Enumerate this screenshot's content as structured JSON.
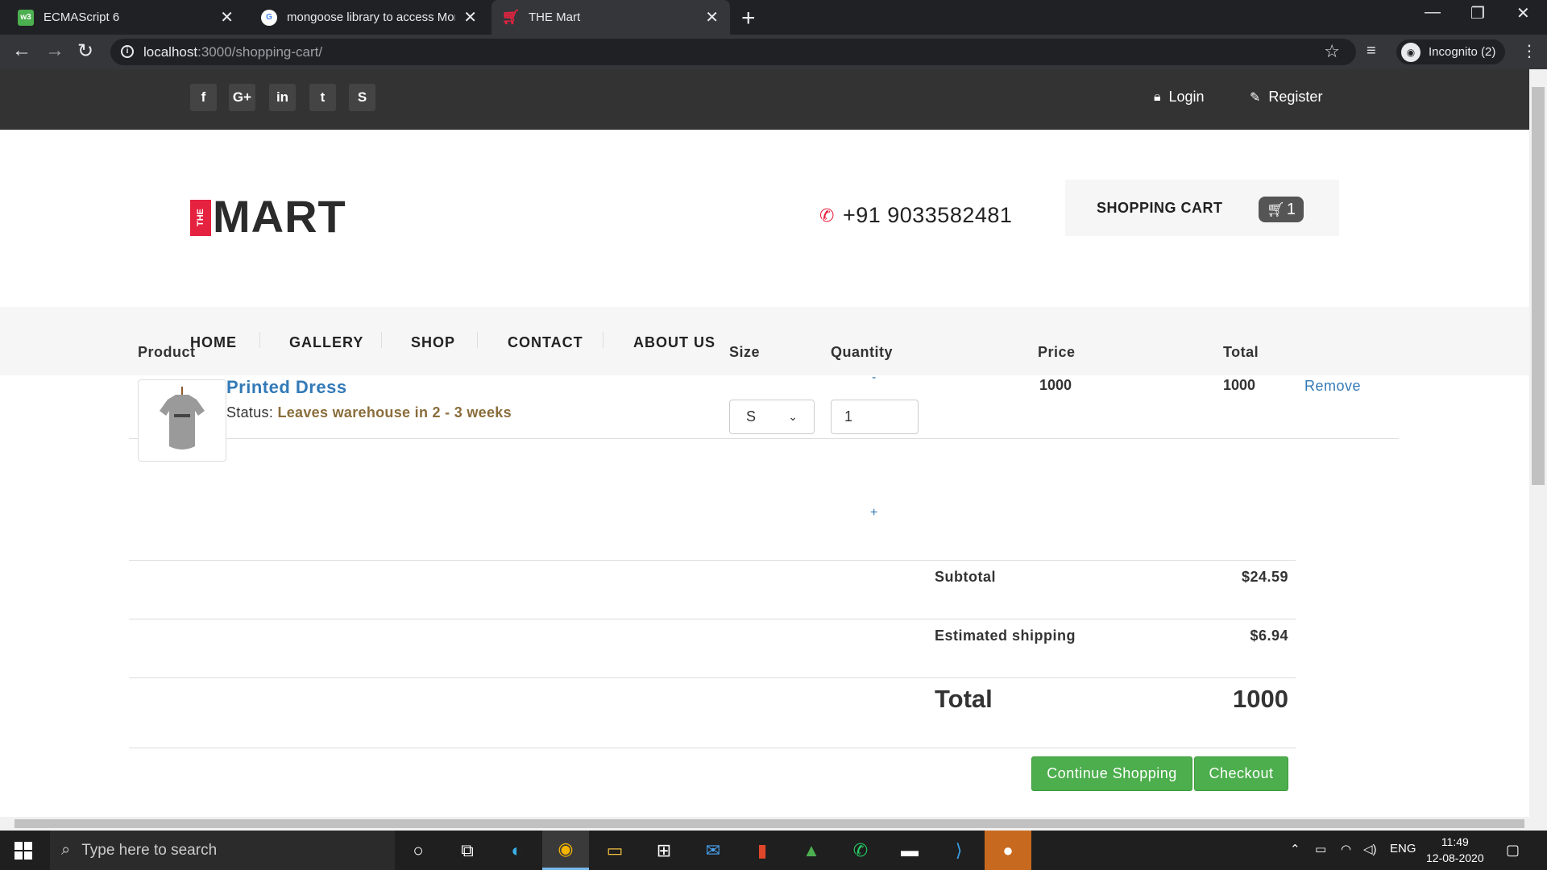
{
  "browser": {
    "tabs": [
      {
        "title": "ECMAScript 6",
        "favicon": "w3-icon",
        "active": false
      },
      {
        "title": "mongoose library to access Mon",
        "favicon": "google-icon",
        "active": false
      },
      {
        "title": "THE Mart",
        "favicon": "cart-icon",
        "active": true
      }
    ],
    "url_host": "localhost",
    "url_rest": ":3000/shopping-cart/",
    "profile_label": "Incognito (2)"
  },
  "site": {
    "social": [
      "f",
      "G+",
      "in",
      "t",
      "S"
    ],
    "login_label": "Login",
    "register_label": "Register",
    "logo_small": "THE",
    "logo_big": "MART",
    "phone": "+91 9033582481",
    "cart_label": "SHOPPING CART",
    "cart_count": "1",
    "menu": [
      "HOME",
      "GALLERY",
      "SHOP",
      "CONTACT",
      "ABOUT US"
    ]
  },
  "cart": {
    "headers": {
      "product": "Product",
      "size": "Size",
      "quantity": "Quantity",
      "price": "Price",
      "total": "Total"
    },
    "item": {
      "name": "Printed Dress",
      "status_prefix": "Status:",
      "status": "Leaves warehouse in 2 - 3 weeks",
      "size": "S",
      "qty_minus": "-",
      "qty": "1",
      "qty_plus": "+",
      "price": "1000",
      "total": "1000",
      "remove_label": "Remove"
    },
    "subtotal_label": "Subtotal",
    "subtotal": "$24.59",
    "shipping_label": "Estimated shipping",
    "shipping": "$6.94",
    "total_label": "Total",
    "total": "1000",
    "continue_label": "Continue Shopping",
    "checkout_label": "Checkout"
  },
  "taskbar": {
    "search_placeholder": "Type here to search",
    "lang": "ENG",
    "time": "11:49",
    "date": "12-08-2020"
  },
  "colors": {
    "brand_red": "#e5223f",
    "link_blue": "#337ab7",
    "button_green": "#4cae4c",
    "status_brown": "#8a6d3b"
  }
}
